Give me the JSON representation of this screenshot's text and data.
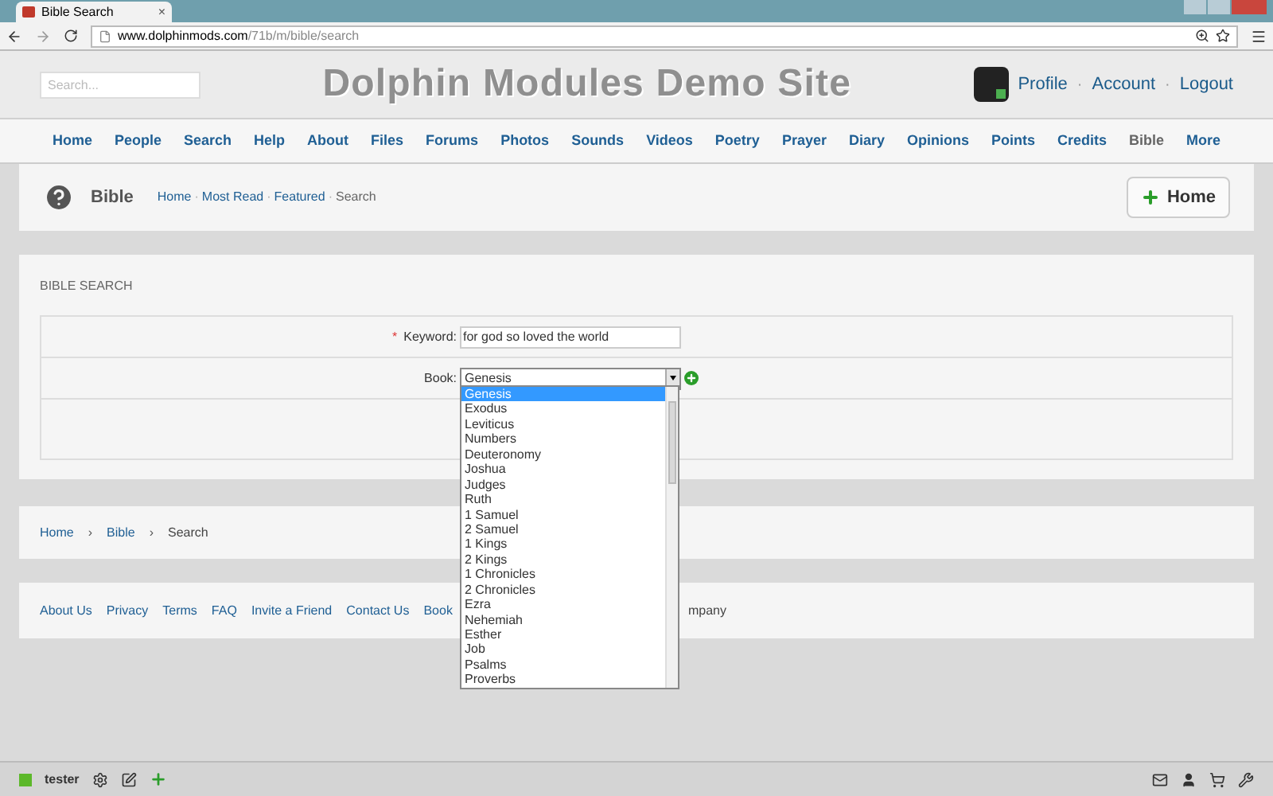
{
  "browser": {
    "tab_title": "Bible Search",
    "tab_close": "×",
    "url_host": "www.dolphinmods.com",
    "url_path": "/71b/m/bible/search"
  },
  "header": {
    "search": {
      "placeholder": "Search..."
    },
    "site_title": "Dolphin Modules Demo Site",
    "user_links": [
      "Profile",
      "Account",
      "Logout"
    ],
    "link_separator": "·"
  },
  "nav": [
    {
      "label": "Home",
      "selected": false
    },
    {
      "label": "People",
      "selected": false
    },
    {
      "label": "Search",
      "selected": false
    },
    {
      "label": "Help",
      "selected": false
    },
    {
      "label": "About",
      "selected": false
    },
    {
      "label": "Files",
      "selected": false
    },
    {
      "label": "Forums",
      "selected": false
    },
    {
      "label": "Photos",
      "selected": false
    },
    {
      "label": "Sounds",
      "selected": false
    },
    {
      "label": "Videos",
      "selected": false
    },
    {
      "label": "Poetry",
      "selected": false
    },
    {
      "label": "Prayer",
      "selected": false
    },
    {
      "label": "Diary",
      "selected": false
    },
    {
      "label": "Opinions",
      "selected": false
    },
    {
      "label": "Points",
      "selected": false
    },
    {
      "label": "Credits",
      "selected": false
    },
    {
      "label": "Bible",
      "selected": true
    },
    {
      "label": "More",
      "selected": false
    }
  ],
  "page_header": {
    "title": "Bible",
    "submenu": [
      {
        "label": "Home",
        "selected": false
      },
      {
        "label": "Most Read",
        "selected": false
      },
      {
        "label": "Featured",
        "selected": false
      },
      {
        "label": "Search",
        "selected": true
      }
    ],
    "submenu_separator": "·",
    "button": "Home"
  },
  "search_panel": {
    "title": "BIBLE SEARCH",
    "keyword": {
      "required": true,
      "required_mark": "*",
      "label": "Keyword:",
      "value": "for god so loved the world"
    },
    "book": {
      "label": "Book:",
      "value": "Genesis",
      "options": [
        {
          "label": "Genesis",
          "selected": true
        },
        {
          "label": "Exodus",
          "selected": false
        },
        {
          "label": "Leviticus",
          "selected": false
        },
        {
          "label": "Numbers",
          "selected": false
        },
        {
          "label": "Deuteronomy",
          "selected": false
        },
        {
          "label": "Joshua",
          "selected": false
        },
        {
          "label": "Judges",
          "selected": false
        },
        {
          "label": "Ruth",
          "selected": false
        },
        {
          "label": "1 Samuel",
          "selected": false
        },
        {
          "label": "2 Samuel",
          "selected": false
        },
        {
          "label": "1 Kings",
          "selected": false
        },
        {
          "label": "2 Kings",
          "selected": false
        },
        {
          "label": "1 Chronicles",
          "selected": false
        },
        {
          "label": "2 Chronicles",
          "selected": false
        },
        {
          "label": "Ezra",
          "selected": false
        },
        {
          "label": "Nehemiah",
          "selected": false
        },
        {
          "label": "Esther",
          "selected": false
        },
        {
          "label": "Job",
          "selected": false
        },
        {
          "label": "Psalms",
          "selected": false
        },
        {
          "label": "Proverbs",
          "selected": false
        }
      ]
    }
  },
  "breadcrumb": {
    "items": [
      "Home",
      "Bible",
      "Search"
    ],
    "separator": "›"
  },
  "footer": {
    "links": [
      "About Us",
      "Privacy",
      "Terms",
      "FAQ",
      "Invite a Friend",
      "Contact Us",
      "Book"
    ],
    "after_dropdown": "mpany"
  },
  "bottom_bar": {
    "user": "tester"
  }
}
